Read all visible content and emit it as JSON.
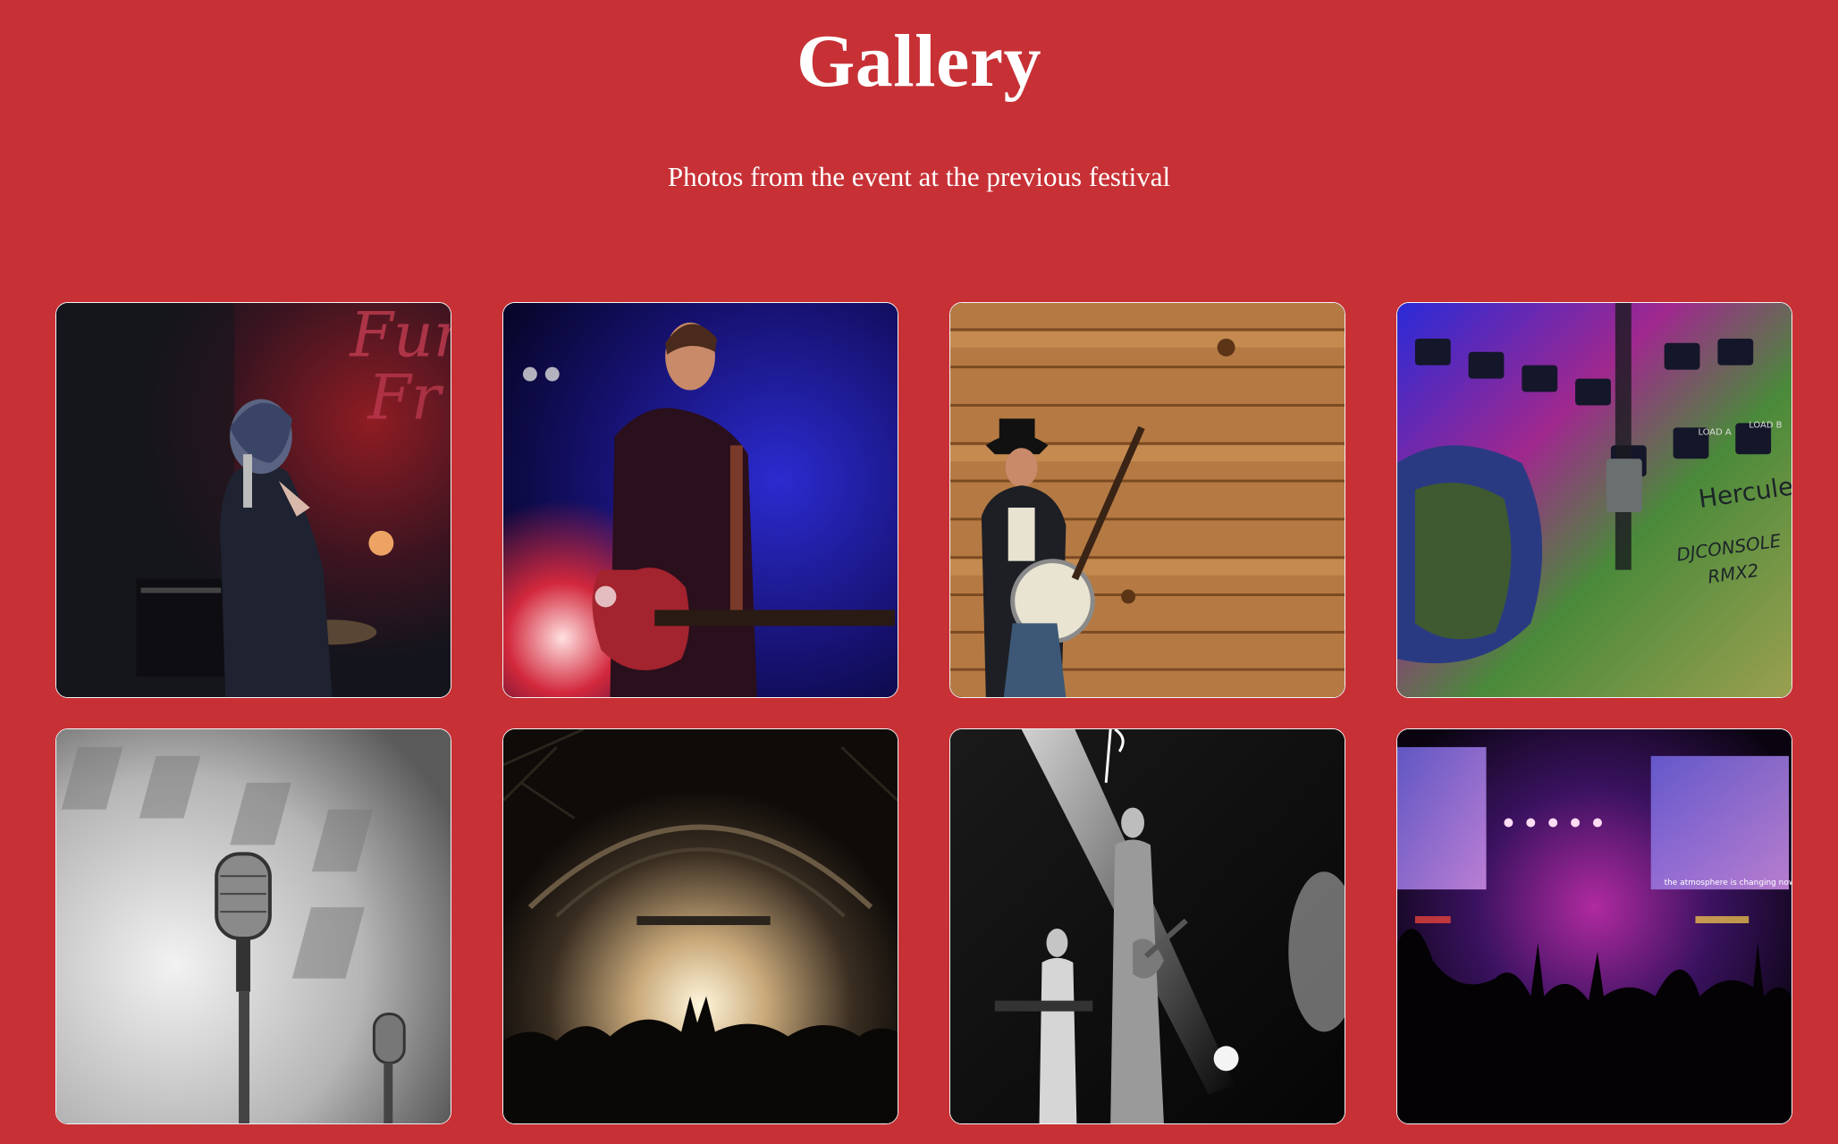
{
  "header": {
    "title": "Gallery",
    "subtitle": "Photos from the event at the previous festival"
  },
  "gallery": {
    "photos": [
      {
        "subject": "singer-with-microphone",
        "icon": "photo-singer"
      },
      {
        "subject": "guitarist-blue-stage-light",
        "icon": "photo-guitarist"
      },
      {
        "subject": "banjo-player-wooden-wall",
        "icon": "photo-banjo"
      },
      {
        "subject": "dj-console-mixer",
        "icon": "photo-dj-console",
        "printed_text": [
          "Hercules",
          "DJCONSOLE",
          "RMX2",
          "LOAD A",
          "LOAD B"
        ]
      },
      {
        "subject": "vintage-microphones-monochrome",
        "icon": "photo-microphones"
      },
      {
        "subject": "concert-arch-crowd",
        "icon": "photo-arch-crowd"
      },
      {
        "subject": "band-monochrome-stage",
        "icon": "photo-band-mono"
      },
      {
        "subject": "purple-stage-crowd",
        "icon": "photo-purple-stage",
        "printed_text": [
          "the atmosphere is changing now"
        ]
      }
    ]
  },
  "colors": {
    "background": "#c73136",
    "text": "#ffffff",
    "card_border": "#f4f4f4"
  }
}
